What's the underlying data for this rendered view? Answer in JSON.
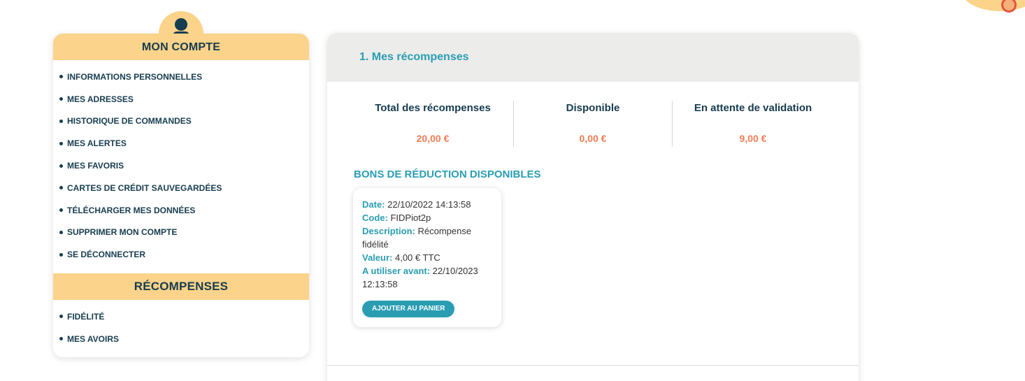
{
  "sidebar": {
    "account_title": "MON COMPTE",
    "account_items": [
      "INFORMATIONS PERSONNELLES",
      "MES ADRESSES",
      "HISTORIQUE DE COMMANDES",
      "MES ALERTES",
      "MES FAVORIS",
      "CARTES DE CRÉDIT SAUVEGARDÉES",
      "TÉLÉCHARGER MES DONNÉES",
      "SUPPRIMER MON COMPTE",
      "SE DÉCONNECTER"
    ],
    "rewards_title": "RÉCOMPENSES",
    "rewards_items": [
      "FIDÉLITÉ",
      "MES AVOIRS"
    ]
  },
  "main": {
    "section_title": "1. Mes récompenses",
    "stats": [
      {
        "label": "Total des récompenses",
        "value": "20,00 €"
      },
      {
        "label": "Disponible",
        "value": "0,00 €"
      },
      {
        "label": "En attente de validation",
        "value": "9,00 €"
      }
    ],
    "vouchers_title": "BONS DE RÉDUCTION DISPONIBLES",
    "voucher": {
      "date_key": "Date:",
      "date_val": "22/10/2022 14:13:58",
      "code_key": "Code:",
      "code_val": "FIDPiot2p",
      "desc_key": "Description:",
      "desc_val": "Récompense fidélité",
      "value_key": "Valeur:",
      "value_val": "4,00 € TTC",
      "expiry_key": "A utiliser avant:",
      "expiry_val": "22/10/2023 12:13:58",
      "button_label": "AJOUTER AU PANIER"
    }
  },
  "colors": {
    "accent_yellow": "#fbd38a",
    "navy": "#163c4f",
    "teal": "#2a9db3",
    "orange": "#f07c55"
  }
}
